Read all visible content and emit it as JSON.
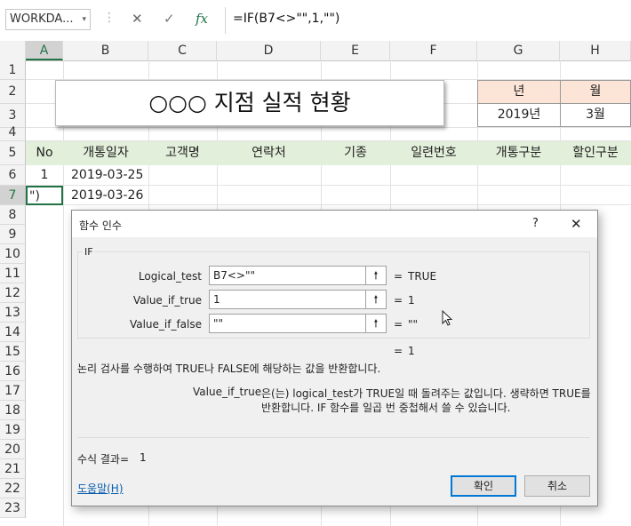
{
  "formula_bar": {
    "name_box": "WORKDA...",
    "name_box_arrow": "▾",
    "dots": "⋮",
    "cancel_icon": "✕",
    "enter_icon": "✓",
    "fx_icon": "fx",
    "formula": "=IF(B7<>\"\",1,\"\")"
  },
  "columns": [
    "A",
    "B",
    "C",
    "D",
    "E",
    "F",
    "G",
    "H"
  ],
  "rows": [
    "1",
    "2",
    "3",
    "4",
    "5",
    "6",
    "7",
    "8",
    "9",
    "10",
    "11",
    "12",
    "13",
    "14",
    "15",
    "16",
    "17",
    "18",
    "19",
    "20",
    "21",
    "22",
    "23"
  ],
  "sheet": {
    "title": "○○○ 지점  실적 현황",
    "year_header": "년",
    "month_header": "월",
    "year_value": "2019년",
    "month_value": "3월",
    "table_headers": [
      "No",
      "개통일자",
      "고객명",
      "연락처",
      "기종",
      "일련번호",
      "개통구분",
      "할인구분"
    ],
    "row6": {
      "no": "1",
      "date": "2019-03-25"
    },
    "row7": {
      "no": "\")",
      "date": "2019-03-26"
    }
  },
  "dialog": {
    "title": "함수 인수",
    "help_icon": "?",
    "close_icon": "✕",
    "function_name": "IF",
    "args": [
      {
        "label": "Logical_test",
        "value": "B7<>\"\"",
        "result": "TRUE"
      },
      {
        "label": "Value_if_true",
        "value": "1",
        "result": "1"
      },
      {
        "label": "Value_if_false",
        "value": "\"\"",
        "result": "\"\""
      }
    ],
    "equals": "=",
    "overall_result": "1",
    "description": "논리 검사를 수행하여 TRUE나 FALSE에 해당하는 값을 반환합니다.",
    "arg_help_name": "Value_if_true",
    "arg_help_line1": "은(는) logical_test가 TRUE일 때 돌려주는 값입니다. 생략하면 TRUE를",
    "arg_help_line2": "반환합니다. IF 함수를 일곱 번 중첩해서 쓸 수 있습니다.",
    "formula_result_label": "수식 결과=",
    "formula_result_value": "1",
    "help_link": "도움말(H)",
    "ok_label": "확인",
    "cancel_label": "취소"
  }
}
